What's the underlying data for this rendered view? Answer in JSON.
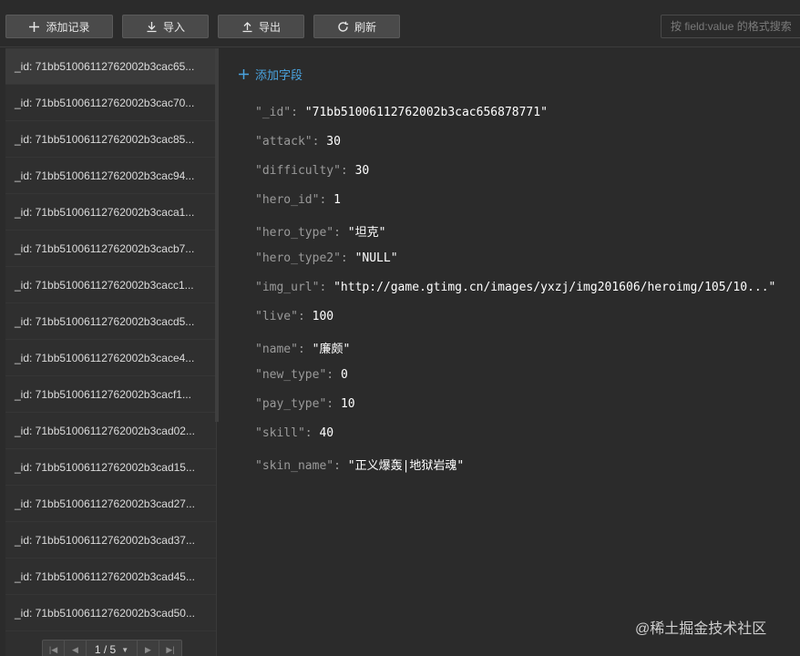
{
  "toolbar": {
    "add_record": "添加记录",
    "import": "导入",
    "export": "导出",
    "refresh": "刷新",
    "search_placeholder": "按 field:value 的格式搜索"
  },
  "records": [
    "_id: 71bb51006112762002b3cac65...",
    "_id: 71bb51006112762002b3cac70...",
    "_id: 71bb51006112762002b3cac85...",
    "_id: 71bb51006112762002b3cac94...",
    "_id: 71bb51006112762002b3caca1...",
    "_id: 71bb51006112762002b3cacb7...",
    "_id: 71bb51006112762002b3cacc1...",
    "_id: 71bb51006112762002b3cacd5...",
    "_id: 71bb51006112762002b3cace4...",
    "_id: 71bb51006112762002b3cacf1...",
    "_id: 71bb51006112762002b3cad02...",
    "_id: 71bb51006112762002b3cad15...",
    "_id: 71bb51006112762002b3cad27...",
    "_id: 71bb51006112762002b3cad37...",
    "_id: 71bb51006112762002b3cad45...",
    "_id: 71bb51006112762002b3cad50..."
  ],
  "pagination": {
    "label": "1 / 5"
  },
  "detail": {
    "add_field": "添加字段",
    "fields": [
      {
        "key": "\"_id\"",
        "value": "\"71bb51006112762002b3cac656878771\""
      },
      {
        "key": "\"attack\"",
        "value": "30"
      },
      {
        "key": "\"difficulty\"",
        "value": "30"
      },
      {
        "key": "\"hero_id\"",
        "value": "1"
      },
      {
        "key": "\"hero_type\"",
        "value": "\"坦克\""
      },
      {
        "key": "\"hero_type2\"",
        "value": "\"NULL\""
      },
      {
        "key": "\"img_url\"",
        "value": "\"http://game.gtimg.cn/images/yxzj/img201606/heroimg/105/10...\""
      },
      {
        "key": "\"live\"",
        "value": "100"
      },
      {
        "key": "\"name\"",
        "value": "\"廉颇\""
      },
      {
        "key": "\"new_type\"",
        "value": "0"
      },
      {
        "key": "\"pay_type\"",
        "value": "10"
      },
      {
        "key": "\"skill\"",
        "value": "40"
      },
      {
        "key": "\"skin_name\"",
        "value": "\"正义爆轰|地狱岩魂\""
      }
    ]
  },
  "watermark": "@稀土掘金技术社区",
  "colors": {
    "accent": "#4aa3df",
    "background": "#2b2b2b"
  }
}
